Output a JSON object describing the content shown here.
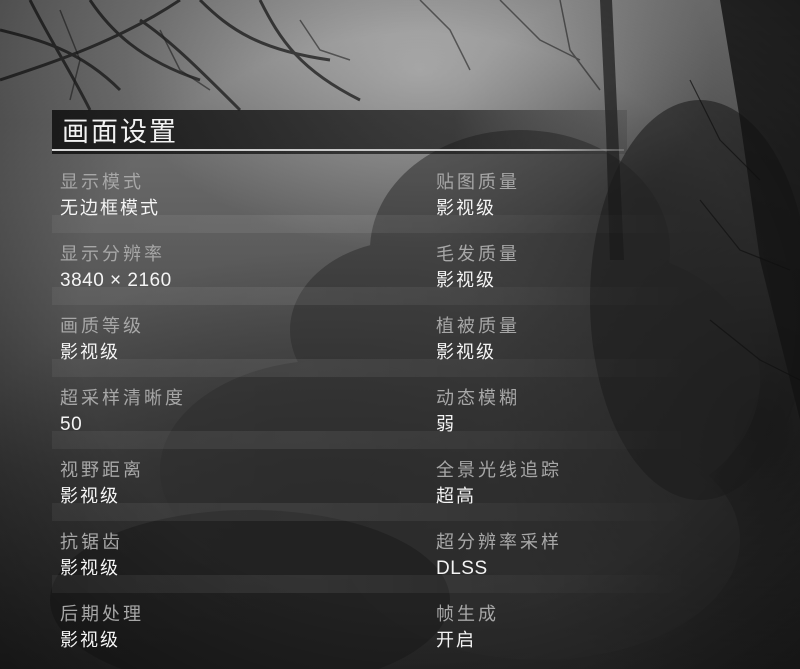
{
  "page": {
    "title": "画面设置"
  },
  "settings": {
    "left": [
      {
        "label": "显示模式",
        "value": "无边框模式"
      },
      {
        "label": "显示分辨率",
        "value": "3840 × 2160"
      },
      {
        "label": "画质等级",
        "value": "影视级"
      },
      {
        "label": "超采样清晰度",
        "value": "50"
      },
      {
        "label": "视野距离",
        "value": "影视级"
      },
      {
        "label": "抗锯齿",
        "value": "影视级"
      },
      {
        "label": "后期处理",
        "value": "影视级"
      }
    ],
    "right": [
      {
        "label": "贴图质量",
        "value": "影视级"
      },
      {
        "label": "毛发质量",
        "value": "影视级"
      },
      {
        "label": "植被质量",
        "value": "影视级"
      },
      {
        "label": "动态模糊",
        "value": "弱"
      },
      {
        "label": "全景光线追踪",
        "value": "超高"
      },
      {
        "label": "超分辨率采样",
        "value": "DLSS"
      },
      {
        "label": "帧生成",
        "value": "开启"
      }
    ]
  },
  "colors": {
    "title_text": "#f2f2f2",
    "label_text": "#a7a7a7",
    "value_text": "#f4f4f4",
    "title_underline": "#d8d8d8"
  }
}
